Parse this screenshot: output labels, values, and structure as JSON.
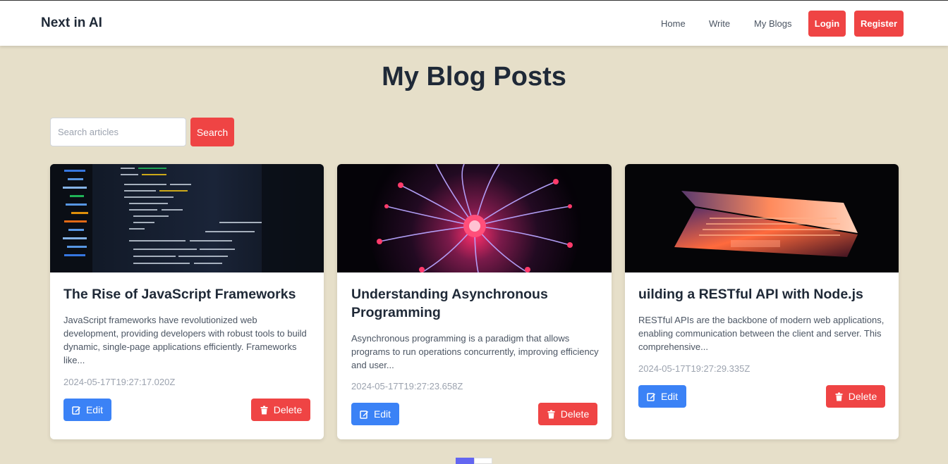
{
  "nav": {
    "brand": "Next in AI",
    "links": [
      "Home",
      "Write",
      "My Blogs"
    ],
    "login": "Login",
    "register": "Register"
  },
  "page_title": "My Blog Posts",
  "search": {
    "placeholder": "Search articles",
    "button": "Search"
  },
  "posts": [
    {
      "title": "The Rise of JavaScript Frameworks",
      "excerpt": "JavaScript frameworks have revolutionized web development, providing developers with robust tools to build dynamic, single-page applications efficiently. Frameworks like...",
      "date": "2024-05-17T19:27:17.020Z",
      "image": "code-editor-image"
    },
    {
      "title": "Understanding Asynchronous Programming",
      "excerpt": "Asynchronous programming is a paradigm that allows programs to run operations concurrently, improving efficiency and user...",
      "date": "2024-05-17T19:27:23.658Z",
      "image": "plasma-ball-image"
    },
    {
      "title": "uilding a RESTful API with Node.js",
      "excerpt": "RESTful APIs are the backbone of modern web applications, enabling communication between the client and server. This comprehensive...",
      "date": "2024-05-17T19:27:29.335Z",
      "image": "laptop-image"
    }
  ],
  "actions": {
    "edit": "Edit",
    "delete": "Delete"
  },
  "colors": {
    "background": "#e6dfc9",
    "accent_red": "#ef4444",
    "edit_blue": "#3b82f6",
    "pagination_active": "#6366f1"
  }
}
